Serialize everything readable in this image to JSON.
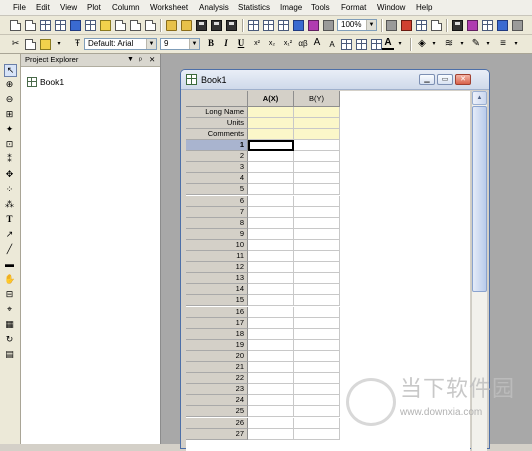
{
  "menu": [
    "File",
    "Edit",
    "View",
    "Plot",
    "Column",
    "Worksheet",
    "Analysis",
    "Statistics",
    "Image",
    "Tools",
    "Format",
    "Window",
    "Help"
  ],
  "toolbar": {
    "zoom": "100%",
    "font_name": "Default: Arial",
    "font_size": "9",
    "bold": "B",
    "italic": "I",
    "underline": "U",
    "superscript": "x²",
    "subscript": "x₂",
    "supsub": "x₁²",
    "greek": "αβ",
    "enlarge_font": "A",
    "reduce_font": "A"
  },
  "project_explorer": {
    "title": "Project Explorer",
    "pin": "ᵖ",
    "close": "✕",
    "items": [
      {
        "label": "Book1"
      }
    ]
  },
  "workbook": {
    "title": "Book1",
    "columns": [
      "A(X)",
      "B(Y)"
    ],
    "meta_rows": [
      "Long Name",
      "Units",
      "Comments"
    ],
    "row_numbers": [
      "1",
      "2",
      "3",
      "4",
      "5",
      "6",
      "7",
      "8",
      "9",
      "10",
      "11",
      "12",
      "13",
      "14",
      "15",
      "16",
      "17",
      "18",
      "19",
      "20",
      "21",
      "22",
      "23",
      "24",
      "25",
      "26",
      "27"
    ],
    "active_row": "1"
  },
  "watermark": {
    "cn": "当下软件园",
    "url": "www.downxia.com"
  }
}
